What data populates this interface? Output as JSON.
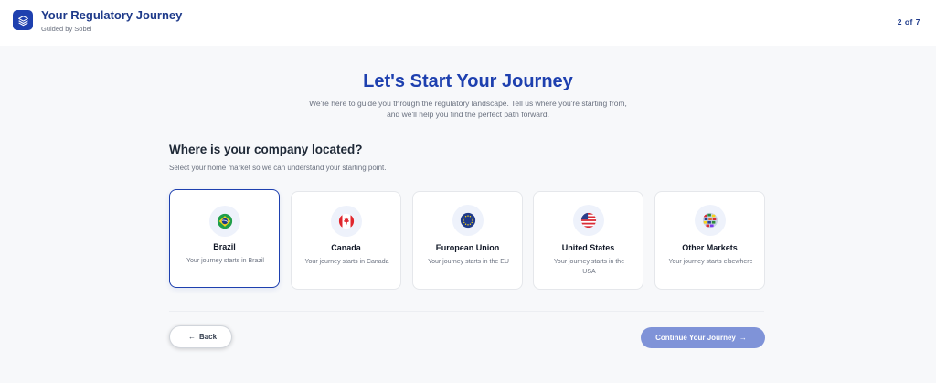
{
  "header": {
    "title": "Your Regulatory Journey",
    "subtitle": "Guided by Sobel",
    "step_current": "2",
    "step_of": "of",
    "step_total": "7"
  },
  "intro": {
    "headline": "Let's Start Your Journey",
    "body": "We're here to guide you through the regulatory landscape. Tell us where you're starting from, and we'll help you find the perfect path forward."
  },
  "question": {
    "title": "Where is your company located?",
    "subtitle": "Select your home market so we can understand your starting point."
  },
  "options": [
    {
      "label": "Brazil",
      "description": "Your journey starts in Brazil",
      "icon": "brazil-flag-icon",
      "selected": true
    },
    {
      "label": "Canada",
      "description": "Your journey starts in Canada",
      "icon": "canada-flag-icon",
      "selected": false
    },
    {
      "label": "European Union",
      "description": "Your journey starts in the EU",
      "icon": "eu-flag-icon",
      "selected": false
    },
    {
      "label": "United States",
      "description": "Your journey starts in the USA",
      "icon": "us-flag-icon",
      "selected": false
    },
    {
      "label": "Other Markets",
      "description": "Your journey starts elsewhere",
      "icon": "globe-flags-icon",
      "selected": false
    }
  ],
  "nav": {
    "back_label": "Back",
    "next_label": "Continue Your Journey"
  },
  "colors": {
    "brand": "#1e40af",
    "continue_button": "#7f93d8",
    "background": "#f7f8fa"
  }
}
